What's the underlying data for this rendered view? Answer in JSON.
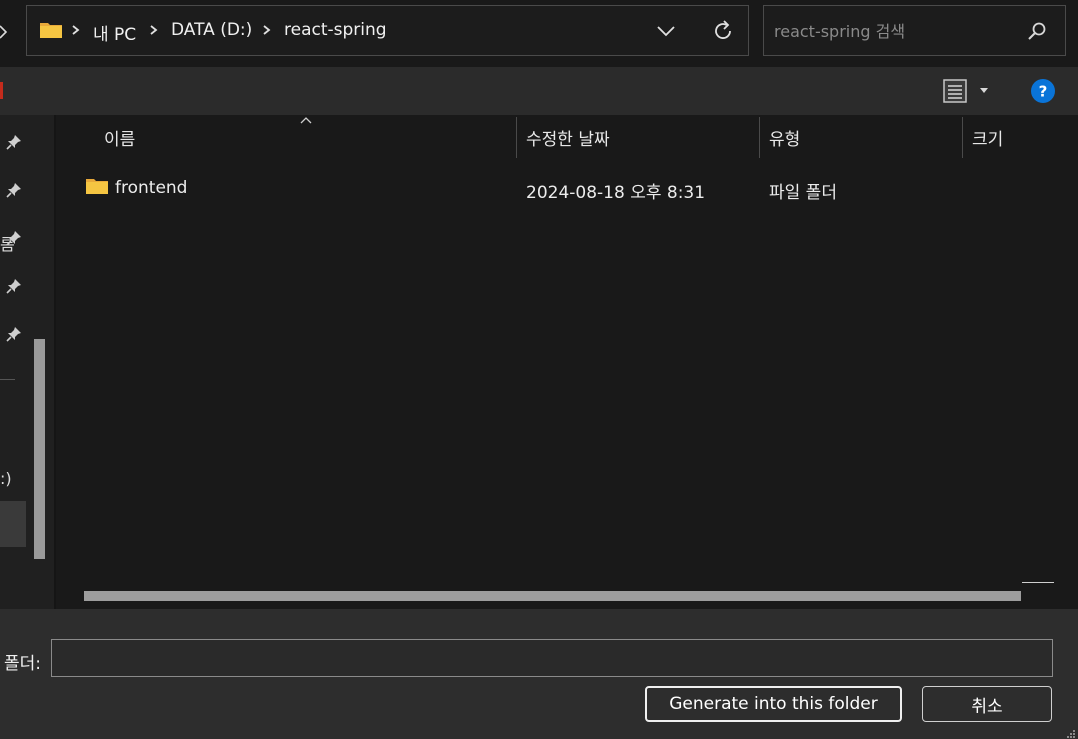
{
  "address_bar": {
    "crumbs": [
      "내 PC",
      "DATA (D:)",
      "react-spring"
    ]
  },
  "search": {
    "placeholder": "react-spring 검색",
    "value": ""
  },
  "nav_pane": {
    "edge_glyph_1": "름",
    "edge_glyph_2": ":)"
  },
  "columns": {
    "name": "이름",
    "modified": "수정한 날짜",
    "type": "유형",
    "size": "크기"
  },
  "files": [
    {
      "name": "frontend",
      "modified": "2024-08-18 오후 8:31",
      "type": "파일 폴더",
      "size": ""
    }
  ],
  "bottom": {
    "folder_label": "폴더:",
    "folder_value": "",
    "generate_label": "Generate into this folder",
    "cancel_label": "취소"
  },
  "colors": {
    "accent": "#0078d4",
    "background": "#191919",
    "folder": "#f5c542"
  },
  "icons": [
    "folder-icon",
    "chevron-right-icon",
    "chevron-down-icon",
    "refresh-icon",
    "search-icon",
    "view-list-icon",
    "help-icon",
    "pin-icon"
  ]
}
